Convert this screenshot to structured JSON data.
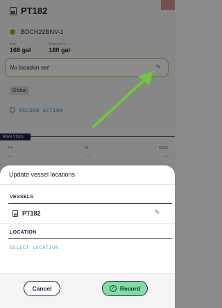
{
  "background": {
    "vessel_title": "PT182",
    "tag_code": "BDCH22BNV-1",
    "fill_label": "FILL",
    "fill_value": "168 gal",
    "capacity_label": "CAPACITY",
    "capacity_value": "180 gal",
    "location_text": "No location set",
    "global_label": "Global",
    "record_action_label": "RECORD ACTION",
    "analyses_label": "ANALYSES",
    "columns": [
      "PH",
      "TA",
      "FSO2"
    ],
    "column_values": [
      "—",
      "—",
      "—"
    ]
  },
  "sheet": {
    "title": "Update vessel locations",
    "vessels_heading": "VESSELS",
    "vessel_name": "PT182",
    "location_heading": "LOCATION",
    "select_location_label": "SELECT LOCATION"
  },
  "footer": {
    "cancel_label": "Cancel",
    "record_label": "Record"
  },
  "icons": {
    "vessel": "vessel-icon",
    "edit": "pencil-icon",
    "record": "check-circle-icon",
    "annotation": "green-arrow"
  },
  "colors": {
    "navy": "#1c2340",
    "accent_blue": "#4e9bd6",
    "record_green": "#7fdfa0",
    "highlight_green": "#7dd04a"
  }
}
